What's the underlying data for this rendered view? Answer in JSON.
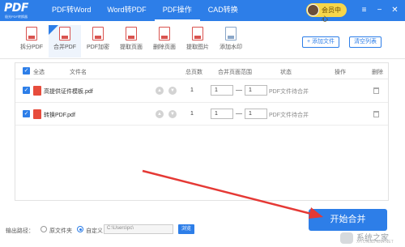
{
  "app": {
    "logo": "PDF",
    "logo_sub": "极光PDF转换器"
  },
  "nav": {
    "tabs": [
      "PDF转Word",
      "Word转PDF",
      "PDF操作",
      "CAD转换"
    ],
    "member": "会员中心"
  },
  "window": {
    "menu": "≡",
    "minimize": "−",
    "close": "✕"
  },
  "tools": [
    {
      "label": "拆分PDF",
      "icon": "split-pdf-icon"
    },
    {
      "label": "合并PDF",
      "icon": "merge-pdf-icon"
    },
    {
      "label": "PDF加密",
      "icon": "lock-pdf-icon"
    },
    {
      "label": "提取页面",
      "icon": "extract-page-icon"
    },
    {
      "label": "删除页面",
      "icon": "delete-page-icon"
    },
    {
      "label": "提取图片",
      "icon": "extract-image-icon"
    },
    {
      "label": "添加水印",
      "icon": "watermark-icon"
    }
  ],
  "actions": {
    "add_file": "+ 添加文件",
    "clear_list": "清空列表"
  },
  "table": {
    "headers": {
      "select_all": "全选",
      "filename": "文件名",
      "pages": "总页数",
      "range": "合并页面范围",
      "status": "状态",
      "op": "操作",
      "delete": "删除"
    },
    "rows": [
      {
        "name": "高提供证件模板.pdf",
        "pages": "1",
        "from": "1",
        "to": "1",
        "status": "PDF文件待合并"
      },
      {
        "name": "转换PDF.pdf",
        "pages": "1",
        "from": "1",
        "to": "1",
        "status": "PDF文件待合并"
      }
    ]
  },
  "footer": {
    "label": "输出路径：",
    "opt_original": "原文件夹",
    "opt_custom": "自定义",
    "path": "C:\\Users\\pc\\",
    "browse": "浏览"
  },
  "start_button": "开始合并",
  "watermark": {
    "title": "系统之家",
    "sub": "XITONGZHIJIA.NET"
  },
  "colors": {
    "primary": "#2d7ee8",
    "annotation_arrow": "#e53935"
  }
}
